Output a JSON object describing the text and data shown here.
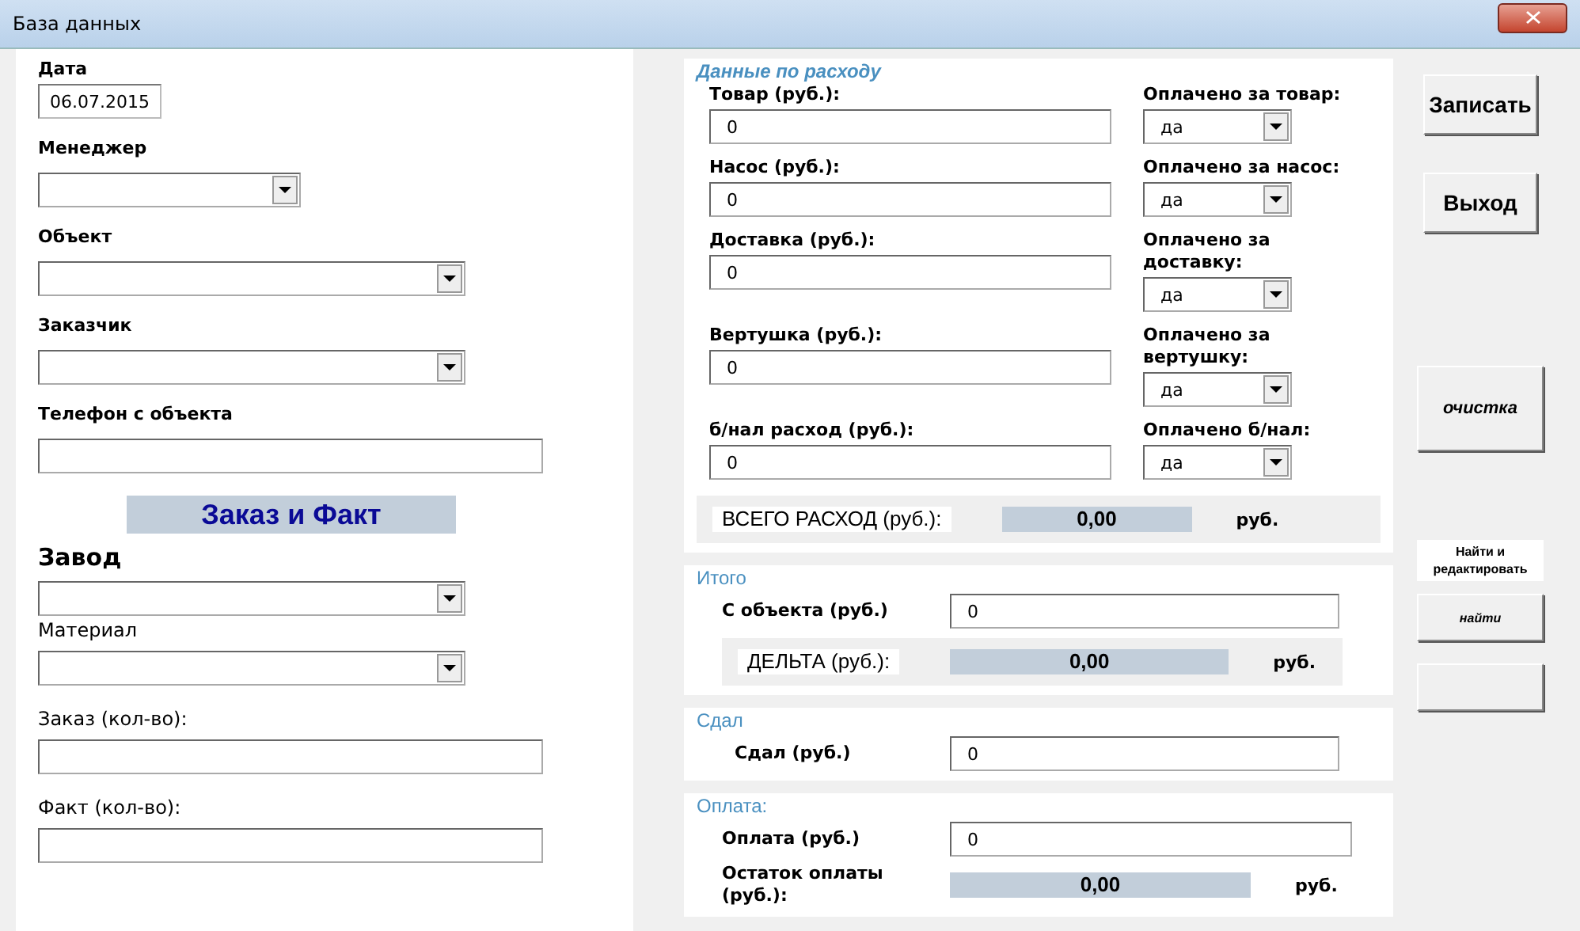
{
  "window": {
    "title": "База данных"
  },
  "left": {
    "date": {
      "label": "Дата",
      "value": "06.07.2015"
    },
    "fields_top": [
      {
        "kind": "combo_short",
        "label": "Менеджер"
      },
      {
        "kind": "combo",
        "label": "Объект"
      },
      {
        "kind": "combo",
        "label": "Заказчик"
      },
      {
        "kind": "text",
        "label": "Телефон с объекта"
      }
    ],
    "banner": "Заказ и Факт",
    "fields_bottom": [
      {
        "kind": "combo",
        "label": "Завод"
      },
      {
        "kind": "combo",
        "label": "Материал"
      },
      {
        "kind": "text",
        "label": "Заказ (кол-во):"
      },
      {
        "kind": "text",
        "label": "Факт (кол-во):"
      }
    ]
  },
  "expenses": {
    "title": "Данные по расходу",
    "rows": [
      {
        "label": "Товар (руб.):",
        "value": "0",
        "paid_label": "Оплачено за товар:",
        "paid_value": "да"
      },
      {
        "label": "Насос (руб.):",
        "value": "0",
        "paid_label": "Оплачено за насос:",
        "paid_value": "да"
      },
      {
        "label": "Доставка (руб.):",
        "value": "0",
        "paid_label": "Оплачено за доставку:",
        "paid_value": "да"
      },
      {
        "label": "Вертушка (руб.):",
        "value": "0",
        "paid_label": "Оплачено за вертушку:",
        "paid_value": "да"
      },
      {
        "label": "б/нал расход (руб.):",
        "value": "0",
        "paid_label": "Оплачено б/нал:",
        "paid_value": "да"
      }
    ],
    "total": {
      "label": "ВСЕГО РАСХОД (руб.):",
      "value": "0,00",
      "unit": "руб."
    }
  },
  "summary": {
    "title": "Итого",
    "field": {
      "label": "С объекта (руб.)",
      "value": "0"
    },
    "delta": {
      "label": "ДЕЛЬТА (руб.):",
      "value": "0,00",
      "unit": "руб."
    }
  },
  "handed": {
    "title": "Сдал",
    "field": {
      "label": "Сдал (руб.)",
      "value": "0"
    }
  },
  "payment": {
    "title": "Оплата:",
    "field": {
      "label": "Оплата (руб.)",
      "value": "0"
    },
    "remainder": {
      "label": "Остаток оплаты (руб.):",
      "value": "0,00",
      "unit": "руб."
    }
  },
  "buttons": [
    {
      "label": "Записать",
      "kind": "large"
    },
    {
      "label": "Выход",
      "kind": "large"
    },
    {
      "label": "очистка",
      "kind": "italic"
    }
  ],
  "find": {
    "caption": "Найти и редактировать",
    "button": "найти"
  }
}
